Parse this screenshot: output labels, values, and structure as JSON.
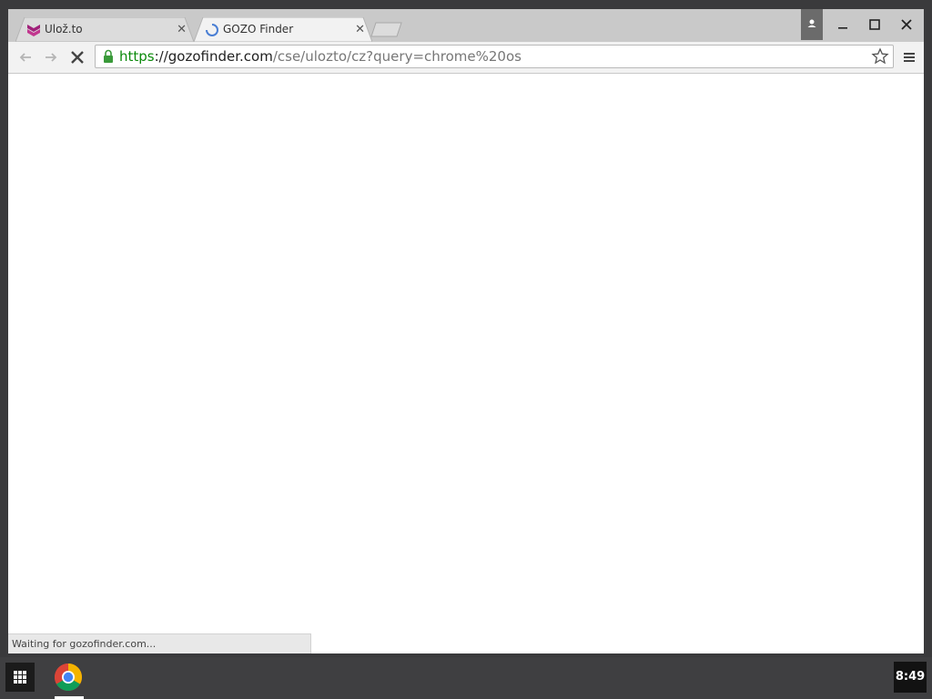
{
  "browser": {
    "tabs": [
      {
        "title": "Ulož.to",
        "active": false,
        "favicon": "ulozto-logo"
      },
      {
        "title": "GOZO Finder",
        "active": true,
        "favicon": "loading-spinner"
      }
    ],
    "omnibox": {
      "scheme": "https",
      "host": "://gozofinder.com",
      "path": "/cse/ulozto/cz?query=chrome%20os"
    },
    "status_text": "Waiting for gozofinder.com...",
    "colors": {
      "tab_active": "#f2f2f2",
      "tab_inactive": "#dcdcdc",
      "secure_green": "#0b8a0b"
    }
  },
  "shelf": {
    "time": "8:49",
    "apps": [
      "launcher-icon",
      "chrome-icon"
    ]
  }
}
